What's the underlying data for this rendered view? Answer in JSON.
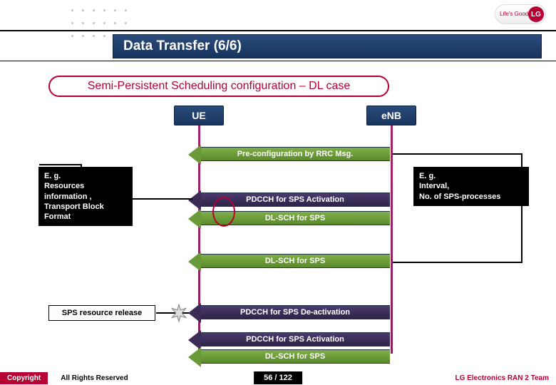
{
  "header": {
    "title": "Data Transfer (6/6)",
    "logo_brand": "LG",
    "logo_tag": "Life's Good"
  },
  "subtitle": "Semi-Persistent Scheduling configuration – DL case",
  "nodes": {
    "ue": "UE",
    "enb": "eNB"
  },
  "messages": {
    "preconfig": "Pre-configuration by RRC Msg.",
    "pdcch_act": "PDCCH for SPS Activation",
    "dlsch1": "DL-SCH for SPS",
    "dlsch2": "DL-SCH for SPS",
    "pdcch_deact": "PDCCH for SPS De-activation",
    "pdcch_act2": "PDCCH for SPS Activation",
    "dlsch3": "DL-SCH for SPS"
  },
  "notes": {
    "left": "E. g.\nResources information ,\nTransport Block Format",
    "right": "E. g.\nInterval,\nNo. of SPS-processes",
    "sps_release": "SPS resource release"
  },
  "footer": {
    "copyright": "Copyright",
    "rights": "All Rights Reserved",
    "page": "56 / 122",
    "team": "LG Electronics RAN 2 Team"
  }
}
